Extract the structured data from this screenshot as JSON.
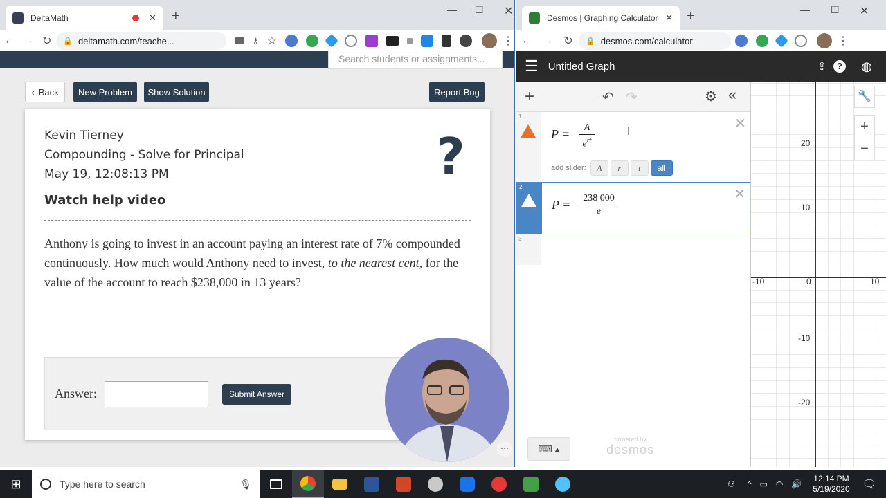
{
  "left_browser": {
    "tab_title": "DeltaMath",
    "url": "deltamath.com/teache...",
    "search_placeholder": "Search students or assignments...",
    "buttons": {
      "back": "Back",
      "new_problem": "New Problem",
      "show_solution": "Show Solution",
      "report_bug": "Report Bug"
    },
    "student_name": "Kevin Tierney",
    "problem_type": "Compounding - Solve for Principal",
    "timestamp": "May 19, 12:08:13 PM",
    "help_link": "Watch help video",
    "question_part1": "Anthony is going to invest in an account paying an interest rate of 7% compounded continuously. How much would Anthony need to invest, ",
    "question_emph": "to the nearest cent",
    "question_part2": ", for the value of the account to reach $238,000 in 13 years?",
    "answer_label": "Answer:",
    "submit_label": "Submit Answer",
    "help_symbol": "?",
    "more_symbol": "⋯"
  },
  "right_browser": {
    "tab_title": "Desmos | Graphing Calculator",
    "url": "desmos.com/calculator",
    "graph_title": "Untitled Graph",
    "expressions": [
      {
        "index": "1",
        "lhs": "P =",
        "num": "A",
        "den": "e",
        "den_exp": "rt"
      },
      {
        "index": "2",
        "lhs": "P =",
        "num": "238 000",
        "den": "e"
      },
      {
        "index": "3"
      }
    ],
    "add_slider_label": "add slider:",
    "sliders": [
      "A",
      "r",
      "t"
    ],
    "slider_all": "all",
    "x_ticks": [
      "-10",
      "0",
      "10"
    ],
    "y_ticks": [
      "20",
      "10",
      "-10",
      "-20"
    ],
    "powered_by": "powered by",
    "brand": "desmos"
  },
  "taskbar": {
    "search_placeholder": "Type here to search",
    "time": "12:14 PM",
    "date": "5/19/2020"
  },
  "colors": {
    "deltamath_navy": "#2c3e50",
    "desmos_blue": "#4a86c5",
    "warn_orange": "#e8702a"
  }
}
